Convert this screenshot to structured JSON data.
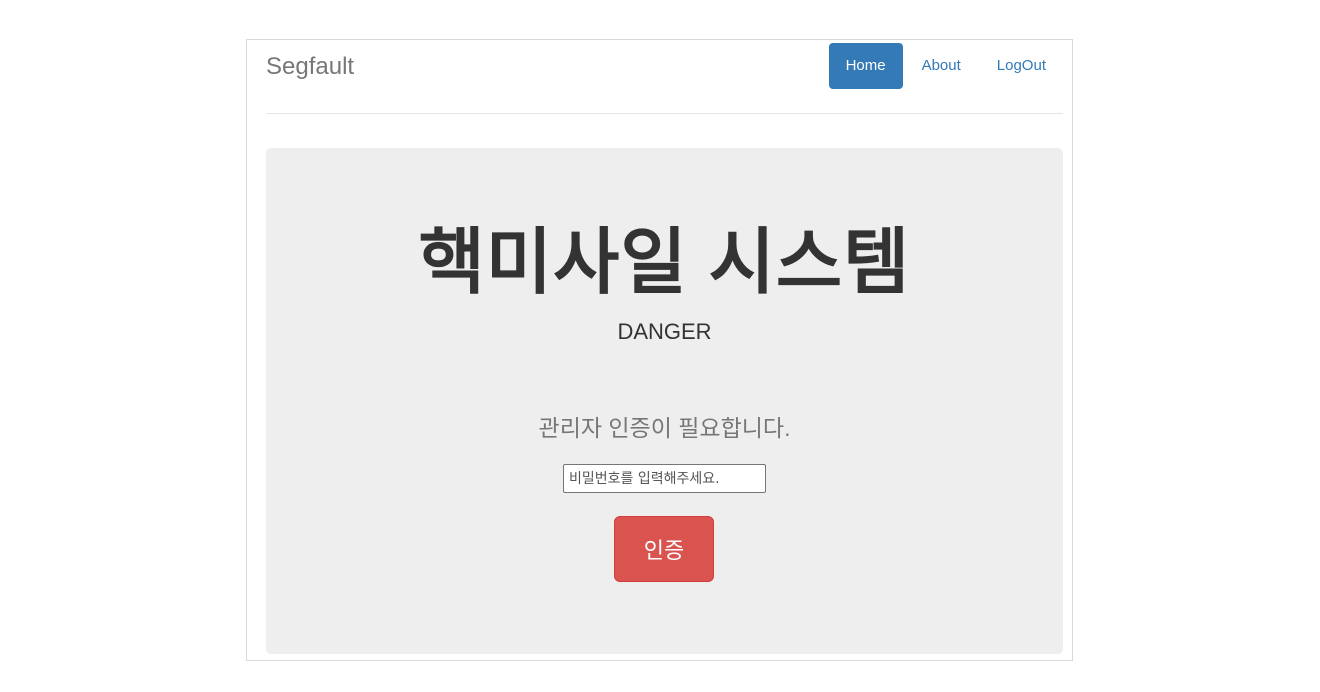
{
  "navbar": {
    "brand": "Segfault",
    "items": [
      {
        "label": "Home",
        "active": true
      },
      {
        "label": "About",
        "active": false
      },
      {
        "label": "LogOut",
        "active": false
      }
    ]
  },
  "main": {
    "title": "핵미사일 시스템",
    "subtitle": "DANGER",
    "auth_message": "관리자 인증이 필요합니다.",
    "password_placeholder": "비밀번호를 입력해주세요.",
    "password_value": "",
    "auth_button_label": "인증"
  },
  "colors": {
    "primary": "#337ab7",
    "danger": "#d9534f",
    "jumbotron_bg": "#eeeeee"
  }
}
